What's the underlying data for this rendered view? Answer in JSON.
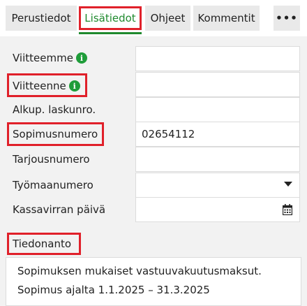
{
  "tabs": {
    "perustiedot": "Perustiedot",
    "lisatiedot": "Lisätiedot",
    "ohjeet": "Ohjeet",
    "kommentit": "Kommentit",
    "more": "•••"
  },
  "form": {
    "viitteemme_label": "Viitteemme",
    "viitteenne_label": "Viitteenne",
    "alkup_label": "Alkup. laskunro.",
    "sopimusnumero_label": "Sopimusnumero",
    "sopimusnumero_value": "02654112",
    "tarjousnumero_label": "Tarjousnumero",
    "tyomaanumero_label": "Työmaanumero",
    "kassavirta_label": "Kassavirran päivä",
    "tiedonanto_label": "Tiedonanto",
    "tiedonanto_line1": "Sopimuksen mukaiset vastuuvakuutusmaksut.",
    "tiedonanto_line2": "Sopimus ajalta 1.1.2025 – 31.3.2025",
    "info_glyph": "i"
  },
  "colors": {
    "accent": "#1f8a2e",
    "highlight": "#e0202a",
    "info": "#1f9d3a"
  }
}
